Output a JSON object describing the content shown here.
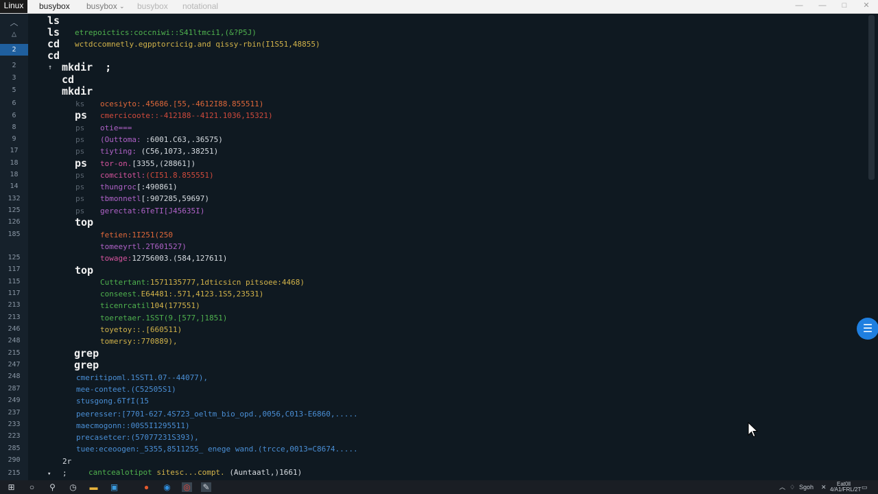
{
  "window": {
    "logo": "Linux",
    "tabs": [
      "busybox",
      "busybox",
      "busybox",
      "notational"
    ]
  },
  "gutter_lines": [
    {
      "num": "2",
      "active": true
    },
    {
      "num": "2"
    },
    {
      "num": "3"
    },
    {
      "num": "5"
    },
    {
      "num": "6"
    },
    {
      "num": "6"
    },
    {
      "num": "8"
    },
    {
      "num": "9"
    },
    {
      "num": "17"
    },
    {
      "num": "18"
    },
    {
      "num": "18"
    },
    {
      "num": "14"
    },
    {
      "num": "132"
    },
    {
      "num": "125"
    },
    {
      "num": "126"
    },
    {
      "num": "185"
    },
    {
      "num": "125"
    },
    {
      "num": "117"
    },
    {
      "num": "115"
    },
    {
      "num": "117"
    },
    {
      "num": "213"
    },
    {
      "num": "213"
    },
    {
      "num": "246"
    },
    {
      "num": "248"
    },
    {
      "num": "215"
    },
    {
      "num": "247"
    },
    {
      "num": "248"
    },
    {
      "num": "287"
    },
    {
      "num": "249"
    },
    {
      "num": "237"
    },
    {
      "num": "233"
    },
    {
      "num": "223"
    },
    {
      "num": "285"
    },
    {
      "num": "290"
    },
    {
      "num": "215"
    }
  ],
  "code": {
    "l1_kw": "ls",
    "l2_kw": "ls",
    "l2_text": "etrepoictics:coccniwi::S41ltmci1,(&?P5J)",
    "l3_kw": "cd",
    "l3_text": "wctdccomnetly.egpptorcicig.and qissy-rbin(I1S51,48855)",
    "l4_kw": "cd",
    "l5_kw": "mkdir  ;",
    "l6_kw": "cd",
    "l7_kw": "mkdir",
    "l8_pre": "ks",
    "l8_text": "ocesiyto:.45686.[55,-4612I88.855511)",
    "l9_kw": "ps",
    "l9_text": "cmercicoote::-412188--4121.1036,15321)",
    "l10_pre": "ps",
    "l10_text": "otie===",
    "l11_pre": "ps",
    "l11_a": "(Outtoma: ",
    "l11_b": ":6001.C63,.36575)",
    "l12_pre": "ps",
    "l12_a": "tiyting: ",
    "l12_b": "(C56,1073,.38251)",
    "l13_kw": "ps",
    "l13_a": "tor-on.",
    "l13_b": "[3355,(28861])",
    "l14_pre": "ps",
    "l14_a": "comcitotl:",
    "l14_b": "(CI51.8.855551)",
    "l15_pre": "ps",
    "l15_a": "thungroc",
    "l15_b": "[:490861)",
    "l16_pre": "ps",
    "l16_a": "tbmonnetl",
    "l16_b": "[:907285,59697)",
    "l17_pre": "ps",
    "l17_text": "gerectat:6TeTI[J45635I)",
    "l18_kw": "top",
    "l19_text": "fetien:1I251(250",
    "l20_text": "tomeeyrtl.2T601527)",
    "l21_a": "towage:",
    "l21_b": "12756003.(584,127611)",
    "l22_kw": "top",
    "l23_a": "Cuttertant:",
    "l23_b": "1571135777,1dticsicn",
    "l23_c": "pitsoee:4468)",
    "l24_a": "conseest.",
    "l24_b": "E64481:.571,4123.1S5,23531)",
    "l25_a": "ticenrcatil",
    "l25_b": "104(177551)",
    "l26_text": "toeretaer.1SST(9.[577,]1851)",
    "l27_text": "toyetoy::.[660511)",
    "l28_text": "tomersy::770889),",
    "l29_kw": "grep",
    "l30_kw": "grep",
    "l31_text": "cmeritipoml.1SST1.07--44077),",
    "l32_text": "mee-conteet.(C52505S1)",
    "l33_text": "stusgong.6TfI(15",
    "l34_text": "peeresser:[7701-627.4S723_oeltm_bio_opd.,0056,C013-E6860,.....",
    "l35_text": "maecmogonn::00S5I1295511)",
    "l36_text": "precasetcer:(57077231S393),",
    "l37_text": "tuee:eceoogen:_5355,8511255_ enege wand.(trcce,0013=C8674.....",
    "l38_text": "2r",
    "l39_pre": ";",
    "l39_a": "cantcealotipot",
    "l39_b": "sitesc...compt.",
    "l39_c": "(Auntaatl,)1661)"
  },
  "taskbar": {
    "tray_text": "Sgoh",
    "clock_time": "Eat0ll",
    "clock_date": "4/A1/FRL/2T"
  },
  "colors": {
    "background": "#0f1921",
    "gutter": "#16212b",
    "active_line": "#1f5f9e",
    "keyword": "#f2f2f2",
    "accent_blue": "#1f7fe0"
  }
}
